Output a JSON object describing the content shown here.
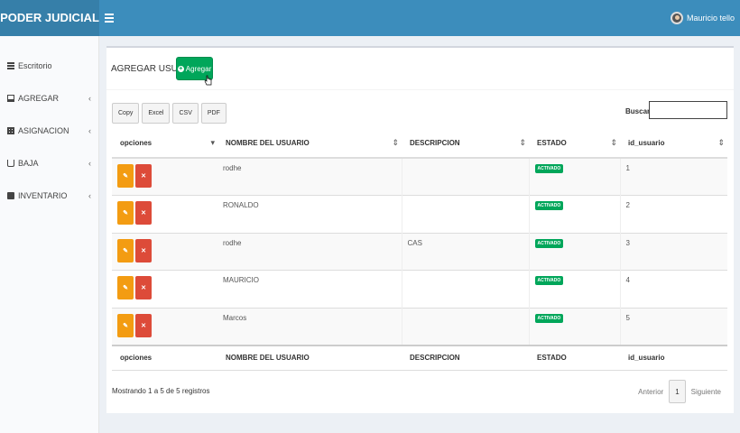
{
  "app": {
    "brand": "PODER JUDICIAL",
    "user_name": "Mauricio tello"
  },
  "sidebar": {
    "items": [
      {
        "label": "Escritorio",
        "icon": "dashboard-icon",
        "has_chevron": false
      },
      {
        "label": "AGREGAR",
        "icon": "laptop-icon",
        "has_chevron": true
      },
      {
        "label": "ASIGNACION",
        "icon": "grid-icon",
        "has_chevron": true
      },
      {
        "label": "BAJA",
        "icon": "cart-icon",
        "has_chevron": true
      },
      {
        "label": "INVENTARIO",
        "icon": "book-icon",
        "has_chevron": true
      }
    ],
    "chevron": "‹"
  },
  "box": {
    "title": "AGREGAR USUARIO",
    "add_label": "Agregar"
  },
  "exports": [
    "Copy",
    "Excel",
    "CSV",
    "PDF"
  ],
  "search": {
    "label": "Buscar:",
    "value": ""
  },
  "table": {
    "columns": [
      "opciones",
      "NOMBRE DEL USUARIO",
      "DESCRIPCION",
      "ESTADO",
      "id_usuario"
    ],
    "rows": [
      {
        "nombre": "rodhe",
        "descripcion": "",
        "estado": "ACTIVADO",
        "id": "1"
      },
      {
        "nombre": "RONALDO",
        "descripcion": "",
        "estado": "ACTIVADO",
        "id": "2"
      },
      {
        "nombre": "rodhe",
        "descripcion": "CAS",
        "estado": "ACTIVADO",
        "id": "3"
      },
      {
        "nombre": "MAURICIO",
        "descripcion": "",
        "estado": "ACTIVADO",
        "id": "4"
      },
      {
        "nombre": "Marcos",
        "descripcion": "",
        "estado": "ACTIVADO",
        "id": "5"
      }
    ]
  },
  "footer": {
    "info": "Mostrando 1 a 5 de 5 registros",
    "prev": "Anterior",
    "page": "1",
    "next": "Siguiente"
  },
  "colors": {
    "topbar": "#3c8dbc",
    "success": "#00a65a",
    "warning": "#f39c12",
    "danger": "#dd4b39"
  }
}
